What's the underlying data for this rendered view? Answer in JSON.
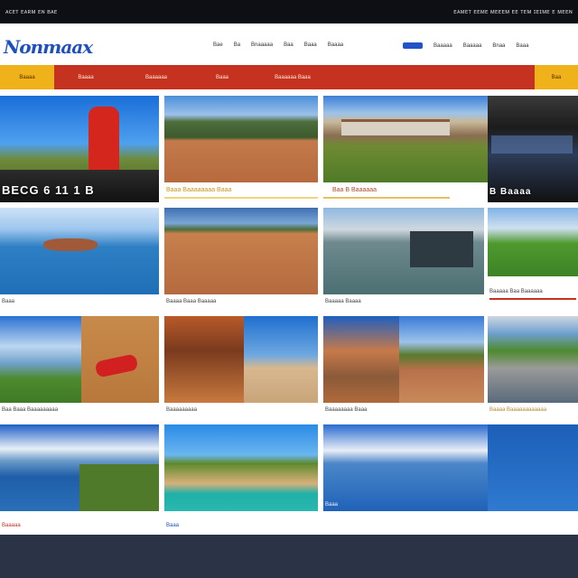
{
  "topbar": {
    "left": "ᴀᴄᴇᴛ ᴇᴀʀᴍ ᴇɴ ʙᴀᴇ",
    "right": "ᴇᴀᴍᴇᴛ ᴇᴇᴍᴇ ᴍᴇᴇᴇᴍ ᴇᴇ ᴛᴇᴍ ɪᴇɪᴍᴇ ᴇ ᴍᴇᴇɴ"
  },
  "header": {
    "logo": "Nonmaax",
    "links": [
      "Bae",
      "Ba",
      "Bnaaaaa",
      "Baa",
      "Baaa",
      "Baaaa"
    ],
    "right": [
      "Baaaaa",
      "Baaaaa",
      "Bnaa",
      "Baaa"
    ]
  },
  "nav": {
    "tabs": [
      "Baaaa",
      "Baaaa",
      "Baaaaaa",
      "Baaa",
      "Baaaaaa Baaa",
      "",
      "",
      "",
      "Baa"
    ]
  },
  "cards": [
    {
      "big": "BECG 6 11 1 B"
    },
    {
      "label": "Baaa Baaaaaaaa Baaa"
    },
    {
      "label": "Baa B Baaaaaa"
    },
    {
      "big": "B Baaaa"
    },
    {
      "caption": "Baaa"
    },
    {
      "caption": "Baaaa Baaa Baaaaa"
    },
    {
      "caption": "Baaaaa Baaaa"
    },
    {
      "caption": "Baaaaa Baa Baaaaaa"
    },
    {
      "caption": "Baa Baaa Baaaaaaaaa"
    },
    {
      "caption": "Baaaaaaaaa"
    },
    {
      "caption": "Baaaaaaaa Baaa"
    },
    {
      "caption": "Baaaa Baaaaaaaaaaaa"
    },
    {
      "caption": "Baaaaa"
    },
    {
      "caption": "Baaa"
    },
    {
      "caption": "Baaa"
    },
    {
      "caption": ""
    }
  ]
}
